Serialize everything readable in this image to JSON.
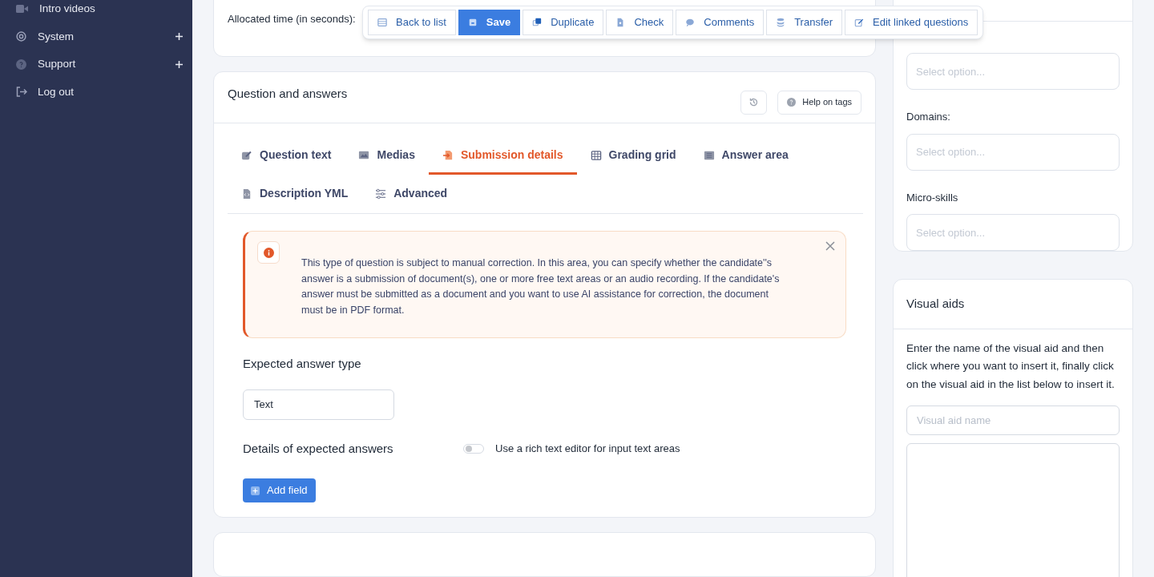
{
  "sidebar": {
    "items": [
      {
        "label": "Intro videos",
        "expandable": false
      },
      {
        "label": "System",
        "expandable": true
      },
      {
        "label": "Support",
        "expandable": true
      },
      {
        "label": "Log out",
        "expandable": false
      }
    ]
  },
  "toolbar": {
    "buttons": [
      {
        "label": "Back to list",
        "primary": false
      },
      {
        "label": "Save",
        "primary": true
      },
      {
        "label": "Duplicate",
        "primary": false
      },
      {
        "label": "Check",
        "primary": false
      },
      {
        "label": "Comments",
        "primary": false
      },
      {
        "label": "Transfer",
        "primary": false
      },
      {
        "label": "Edit linked questions",
        "primary": false
      }
    ]
  },
  "time_card": {
    "label": "Allocated time (in seconds):"
  },
  "question_card": {
    "title": "Question and answers",
    "help_button": "Help on tags",
    "tabs": [
      {
        "label": "Question text",
        "selected": false
      },
      {
        "label": "Medias",
        "selected": false
      },
      {
        "label": "Submission details",
        "selected": true
      },
      {
        "label": "Grading grid",
        "selected": false
      },
      {
        "label": "Answer area",
        "selected": false
      },
      {
        "label": "Description YML",
        "selected": false
      },
      {
        "label": "Advanced",
        "selected": false
      }
    ],
    "alert": "This type of question is subject to manual correction. In this area, you can specify whether the candidate''s answer is a submission of document(s), one or more free text areas or an audio recording. If the candidate's answer must be submitted as a document and you want to use AI assistance for correction, the document must be in PDF format.",
    "expected_type_label": "Expected answer type",
    "expected_type_value": "Text",
    "details_label": "Details of expected answers",
    "rich_text_toggle": {
      "label": "Use a rich text editor for input text areas",
      "on": false
    },
    "add_button": "Add field"
  },
  "tags_card": {
    "fields": [
      {
        "label": "Domains:",
        "placeholder": "Select option..."
      },
      {
        "label": "Micro-skills",
        "placeholder": "Select option..."
      }
    ],
    "top_placeholder": "Select option..."
  },
  "visual_aids": {
    "title": "Visual aids",
    "instructions": "Enter the name of the visual aid and then click where you want to insert it, finally click on the visual aid in the list below to insert it.",
    "placeholder": "Visual aid name"
  }
}
